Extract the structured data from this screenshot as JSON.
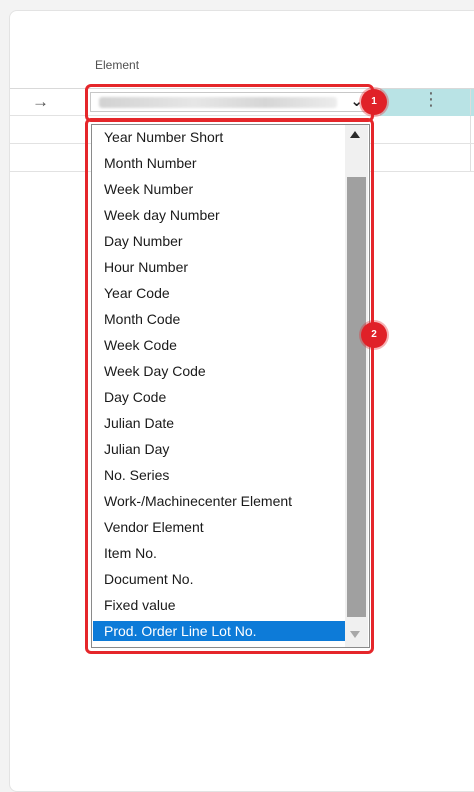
{
  "table": {
    "column_header": "Element",
    "row_arrow": "→",
    "row_menu": "⋮",
    "selected_value_obscured": ""
  },
  "dropdown": {
    "items": [
      "Year Number Short",
      "Month Number",
      "Week Number",
      "Week day Number",
      "Day Number",
      "Hour Number",
      "Year Code",
      "Month Code",
      "Week Code",
      "Week Day Code",
      "Day Code",
      "Julian Date",
      "Julian Day",
      "No. Series",
      "Work-/Machinecenter Element",
      "Vendor Element",
      "Item No.",
      "Document No.",
      "Fixed value",
      "Prod. Order Line Lot No."
    ],
    "selected_item": "Prod. Order Line Lot No.",
    "chevron": "⌄"
  },
  "callouts": {
    "badge1": "1",
    "badge2": "2"
  },
  "colors": {
    "highlight": "#e5262a",
    "selection": "#0d7bd8",
    "row_active": "#b9e3e5"
  }
}
